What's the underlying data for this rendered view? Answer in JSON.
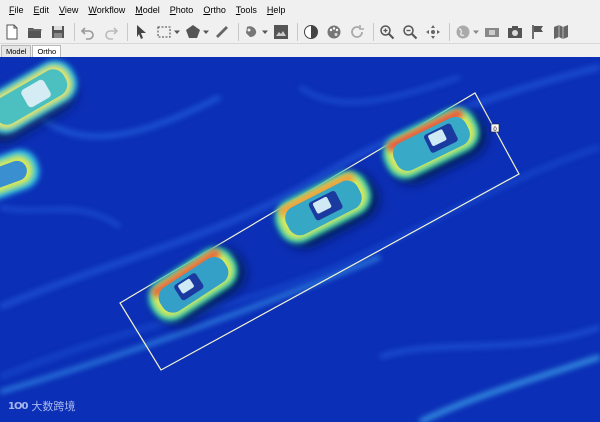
{
  "menu": [
    "File",
    "Edit",
    "View",
    "Workflow",
    "Model",
    "Photo",
    "Ortho",
    "Tools",
    "Help"
  ],
  "menu_accel": [
    "F",
    "E",
    "V",
    "W",
    "M",
    "P",
    "O",
    "T",
    "H"
  ],
  "tabs": [
    "Model",
    "Ortho"
  ],
  "active_tab": "Ortho",
  "toolbar_icons": [
    "new-icon",
    "open-icon",
    "save-icon",
    "undo-icon",
    "redo-icon",
    "navigation-pointer-icon",
    "rectangle-selection-icon",
    "polygon-icon",
    "ruler-icon",
    "brush-icon",
    "image-icon",
    "contrast-icon",
    "palette-icon",
    "reset-view-icon",
    "zoom-in-icon",
    "zoom-out-icon",
    "move-icon",
    "globe-icon",
    "patch-icon",
    "camera-icon",
    "flag-icon",
    "map-icon"
  ],
  "viewport": {
    "mode": "Ortho",
    "background_color": "#0b2fb6",
    "palette": [
      "#0b2fb6",
      "#1f64e0",
      "#2fbfe6",
      "#3ed6a0",
      "#d9e85a",
      "#f4a23a",
      "#e0503a"
    ]
  },
  "selection": {
    "label": "0"
  },
  "watermark": {
    "logo": "1O0",
    "text": "大数跨境"
  }
}
